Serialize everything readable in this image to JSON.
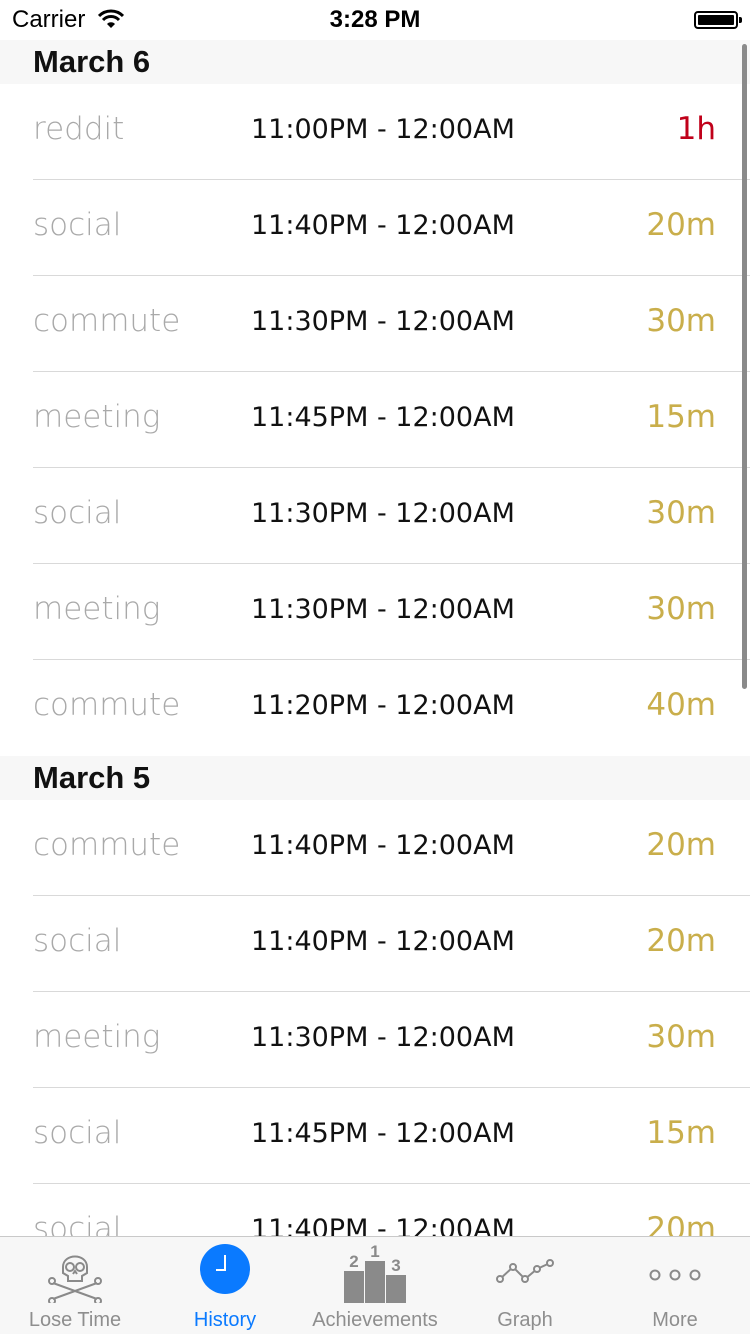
{
  "status_bar": {
    "carrier": "Carrier",
    "time": "3:28 PM"
  },
  "colors": {
    "duration_normal": "#c9ae4b",
    "duration_long": "#c0001a",
    "tab_active": "#0a7aff",
    "tab_inactive": "#8e8e8e"
  },
  "sections": [
    {
      "date": "March 6",
      "entries": [
        {
          "activity": "reddit",
          "time_range": "11:00PM - 12:00AM",
          "duration": "1h",
          "highlight": true
        },
        {
          "activity": "social",
          "time_range": "11:40PM - 12:00AM",
          "duration": "20m",
          "highlight": false
        },
        {
          "activity": "commute",
          "time_range": "11:30PM - 12:00AM",
          "duration": "30m",
          "highlight": false
        },
        {
          "activity": "meeting",
          "time_range": "11:45PM - 12:00AM",
          "duration": "15m",
          "highlight": false
        },
        {
          "activity": "social",
          "time_range": "11:30PM - 12:00AM",
          "duration": "30m",
          "highlight": false
        },
        {
          "activity": "meeting",
          "time_range": "11:30PM - 12:00AM",
          "duration": "30m",
          "highlight": false
        },
        {
          "activity": "commute",
          "time_range": "11:20PM - 12:00AM",
          "duration": "40m",
          "highlight": false
        }
      ]
    },
    {
      "date": "March 5",
      "entries": [
        {
          "activity": "commute",
          "time_range": "11:40PM - 12:00AM",
          "duration": "20m",
          "highlight": false
        },
        {
          "activity": "social",
          "time_range": "11:40PM - 12:00AM",
          "duration": "20m",
          "highlight": false
        },
        {
          "activity": "meeting",
          "time_range": "11:30PM - 12:00AM",
          "duration": "30m",
          "highlight": false
        },
        {
          "activity": "social",
          "time_range": "11:45PM - 12:00AM",
          "duration": "15m",
          "highlight": false
        },
        {
          "activity": "social",
          "time_range": "11:40PM - 12:00AM",
          "duration": "20m",
          "highlight": false
        }
      ]
    }
  ],
  "tab_bar": {
    "tabs": [
      {
        "label": "Lose Time",
        "icon": "skull-crossbones-icon",
        "active": false
      },
      {
        "label": "History",
        "icon": "clock-icon",
        "active": true
      },
      {
        "label": "Achievements",
        "icon": "podium-icon",
        "active": false,
        "podium_ranks": [
          "2",
          "1",
          "3"
        ]
      },
      {
        "label": "Graph",
        "icon": "line-graph-icon",
        "active": false
      },
      {
        "label": "More",
        "icon": "more-dots-icon",
        "active": false
      }
    ]
  }
}
